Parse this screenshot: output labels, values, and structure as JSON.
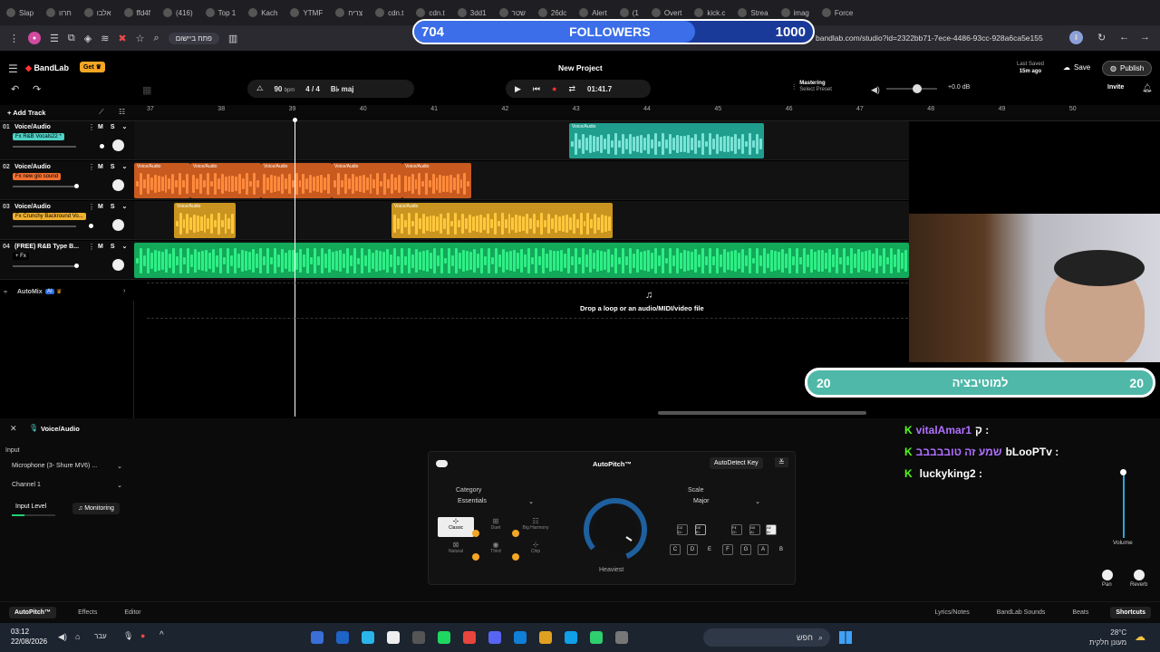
{
  "browser": {
    "tabs": [
      "",
      "",
      "",
      "Slap",
      "",
      "חרוו",
      "",
      "אלבו",
      "",
      "ffd4f",
      "",
      "(416)",
      "",
      "Top 1",
      "",
      "Kach",
      "",
      "YTMF",
      "",
      "צריח",
      "",
      "",
      "cdn.t",
      "",
      "cdn.t",
      "",
      "3dd1",
      "",
      "שטר",
      "",
      "26dc",
      "",
      "Alert",
      "",
      "(1",
      "",
      "Overt",
      "",
      "kick.c",
      "",
      "Strea",
      "",
      "imag",
      "",
      "Force"
    ],
    "url": "bandlab.com/studio?id=2322bb71-7ece-4486-93cc-928a6ca5e155",
    "ext_label": "פתח ביישום"
  },
  "overlay": {
    "followers_count": "704",
    "followers_label": "FOLLOWERS",
    "followers_goal": "1000",
    "followers_progress": 0.704,
    "motivation_left": "20",
    "motivation_label": "למוטיבציה",
    "motivation_right": "20"
  },
  "app": {
    "logo": "BandLab",
    "get_btn": "Get",
    "project_title": "New Project",
    "tempo": "90",
    "tempo_unit": "bpm",
    "time_sig": "4 / 4",
    "key": "maj",
    "key_prefix": "B♭",
    "time": "01:41.7",
    "mastering": "Mastering",
    "select_preset": "Select Preset",
    "volume_db": "+0.0 dB",
    "last_saved": "Last Saved",
    "saved_ago": "15m ago",
    "save": "Save",
    "publish": "Publish",
    "invite": "Invite",
    "add_track": "Add Track"
  },
  "ruler": [
    "37",
    "38",
    "39",
    "40",
    "41",
    "42",
    "43",
    "44",
    "45",
    "46",
    "47",
    "48",
    "49",
    "50"
  ],
  "tracks": [
    {
      "num": "01",
      "name": "Voice/Audio",
      "fx": "Fx R&B Vocals22 *",
      "fx_color": "#4fd1c5",
      "m": "M",
      "s": "S"
    },
    {
      "num": "02",
      "name": "Voice/Audio",
      "fx": "Fx new glo sound",
      "fx_color": "#f07030",
      "m": "M",
      "s": "S"
    },
    {
      "num": "03",
      "name": "Voice/Audio",
      "fx": "Fx Crunchy Backround Vo...",
      "fx_color": "#f0b030",
      "m": "M",
      "s": "S"
    },
    {
      "num": "04",
      "name": "(FREE) R&B Type B...",
      "fx": "+ Fx",
      "fx_color": "#000000",
      "m": "M",
      "s": "S"
    }
  ],
  "clip_label": "Voice/Audio",
  "automix": "AutoMix",
  "automix_badge": "AI",
  "drop_text": "Drop a loop or an audio/MIDI/video file",
  "panel": {
    "title": "Voice/Audio",
    "input": "Input",
    "mic": "Microphone (3- Shure MV6) ...",
    "channel": "Channel 1",
    "input_level": "Input Level",
    "monitoring": "Monitoring",
    "autopitch": "AutoPitch™",
    "autodetect": "AutoDetect Key",
    "category": "Category",
    "category_val": "Essentials",
    "scale": "Scale",
    "scale_val": "Major",
    "options": [
      "Classic",
      "Duet",
      "Big Harmony",
      "Natural",
      "Third",
      "Chip"
    ],
    "knob_label": "Heaviest",
    "keys_top": [
      "C♯ D♭",
      "D♯ E♭",
      "F♯ G♭",
      "G♯ A♭",
      "A♯ B♭"
    ],
    "keys_bottom": [
      "C",
      "D",
      "E",
      "F",
      "G",
      "A",
      "B"
    ],
    "volume": "Volume",
    "pan": "Pan",
    "reverb": "Reverb"
  },
  "bottom_tabs": [
    "AutoPitch™",
    "Effects",
    "Editor"
  ],
  "bottom_right": [
    "Lyrics/Notes",
    "BandLab Sounds",
    "Beats",
    "Shortcuts"
  ],
  "chat": [
    {
      "user": "ק :",
      "msg": "vitalAmar1",
      "color": "#b070ff"
    },
    {
      "user": "bLooPTv :",
      "msg": "שמע זה טובבבבב",
      "color": "#b070ff"
    },
    {
      "user": "luckyking2 :",
      "msg": "",
      "color": "#ff4fb0"
    }
  ],
  "taskbar": {
    "time": "03:12",
    "date": "22/08/2026",
    "lang": "עבר",
    "search": "חפש",
    "weather": "28°C",
    "weather_desc": "מעונן חלקית"
  }
}
